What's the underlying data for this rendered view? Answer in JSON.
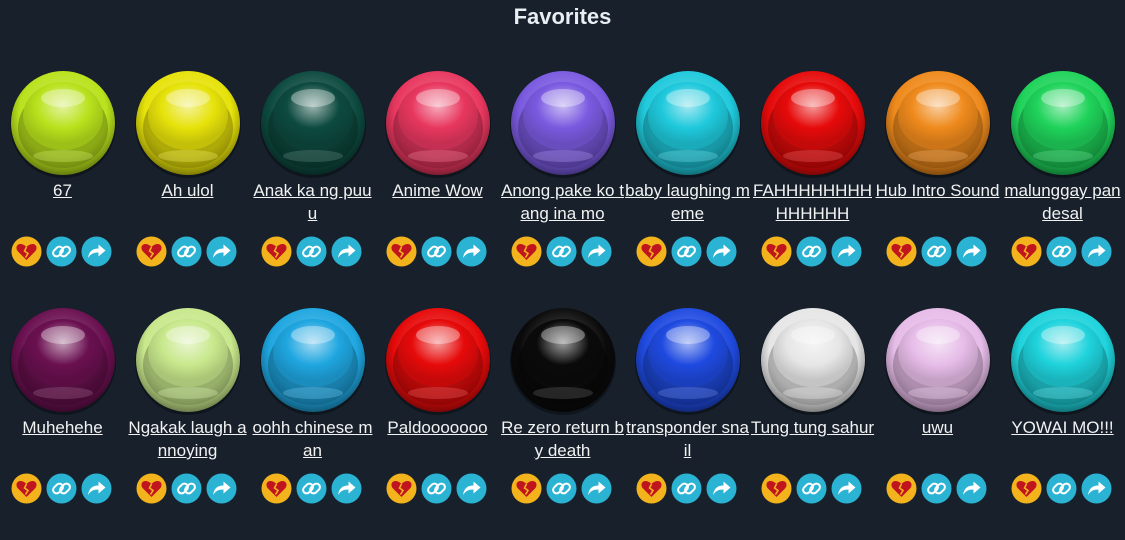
{
  "page": {
    "title": "Favorites"
  },
  "sounds": [
    {
      "label": "67",
      "color": "#b9e21c"
    },
    {
      "label": "Ah ulol",
      "color": "#e6e20a"
    },
    {
      "label": "Anak ka ng puuu",
      "color": "#0d4a3f"
    },
    {
      "label": "Anime Wow",
      "color": "#e8375f"
    },
    {
      "label": "Anong pake ko tang ina mo",
      "color": "#7a5ae0"
    },
    {
      "label": "baby laughing meme",
      "color": "#1fc9dc"
    },
    {
      "label": "FAHHHHHHHHHHHHHH",
      "color": "#e60a0a"
    },
    {
      "label": "Hub Intro Sound",
      "color": "#ef8a1c"
    },
    {
      "label": "malunggay pandesal",
      "color": "#1fd35a"
    },
    {
      "label": "Muhehehe",
      "color": "#6a1050"
    },
    {
      "label": "Ngakak laugh annoying",
      "color": "#c8e88c"
    },
    {
      "label": "oohh chinese man",
      "color": "#1fa6e0"
    },
    {
      "label": "Paldooooooo",
      "color": "#e60a0a"
    },
    {
      "label": "Re zero return by death",
      "color": "#0a0a0a"
    },
    {
      "label": "transponder snail",
      "color": "#1f4ae0"
    },
    {
      "label": "Tung tung sahur",
      "color": "#e6e6e6"
    },
    {
      "label": "uwu",
      "color": "#e6bce8"
    },
    {
      "label": "YOWAI MO!!!",
      "color": "#1fd3dc"
    }
  ],
  "icons": {
    "favorite": "broken-heart-icon",
    "copy_link": "link-icon",
    "share": "share-arrow-icon"
  },
  "colors": {
    "background": "#17202b",
    "favorite_bg": "#f2b31c",
    "action_bg": "#2bb3d3"
  }
}
